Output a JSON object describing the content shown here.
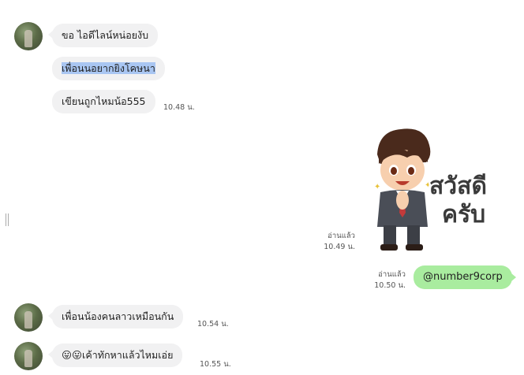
{
  "incoming_group1": {
    "messages": [
      "ขอ ไอดีไลน์หน่อยงับ",
      "เพื่อนนอยากยิงโคษนา",
      "เขียนถูกไหมน้อ555"
    ],
    "time": "10.48 น."
  },
  "sticker": {
    "text_line1": "สวัสดี",
    "text_line2": "ครับ",
    "read_label": "อ่านแล้ว",
    "time": "10.49 น."
  },
  "outgoing": {
    "message": "@number9corp",
    "read_label": "อ่านแล้ว",
    "time": "10.50 น."
  },
  "incoming_group2": {
    "message": "เพื่อนน้องคนลาวเหมือนกัน",
    "time": "10.54 น."
  },
  "incoming_group3": {
    "message": "😛😛เค้าทักหาแล้วไหมเอ่ย",
    "time": "10.55 น."
  }
}
